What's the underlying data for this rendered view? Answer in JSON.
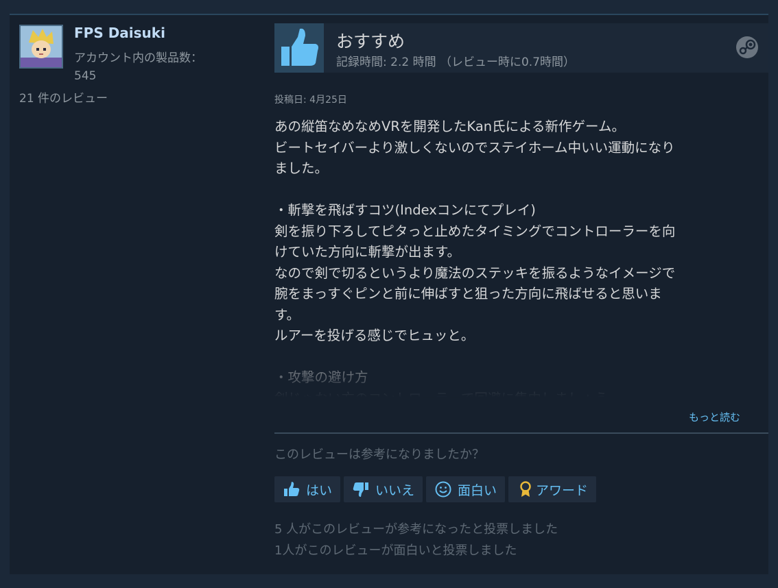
{
  "author": {
    "name": "FPS Daisuki",
    "products_label": "アカウント内の製品数：",
    "products_count": "545",
    "review_count": "21 件のレビュー"
  },
  "header": {
    "recommendation": "おすすめ",
    "hours": "記録時間: 2.2 時間 （レビュー時に0.7時間）"
  },
  "posted": "投稿日: 4月25日",
  "review_lines": [
    "あの縦笛なめなめVRを開発したKan氏による新作ゲーム。",
    "ビートセイバーより激しくないのでステイホーム中いい運動になり",
    "ました。",
    "",
    "・斬撃を飛ばすコツ(Indexコンにてプレイ)",
    "剣を振り下ろしてピタっと止めたタイミングでコントローラーを向",
    "けていた方向に斬撃が出ます。",
    "なので剣で切るというより魔法のステッキを振るようなイメージで",
    "腕をまっすぐピンと前に伸ばすと狙った方向に飛ばせると思いま",
    "す。",
    "ルアーを投げる感じでヒュッと。",
    "",
    "・攻撃の避け方",
    "剣じゃない方のコントローラーで回避に集中しましょう"
  ],
  "read_more": "もっと読む",
  "helpful_question": "このレビューは参考になりましたか？",
  "buttons": {
    "yes": "はい",
    "no": "いいえ",
    "funny": "面白い",
    "award": "アワード"
  },
  "stats": {
    "helpful": "5 人がこのレビューが参考になったと投票しました",
    "funny": "1人がこのレビューが面白いと投票しました"
  },
  "colors": {
    "accent": "#66c0f4",
    "background": "#1b2838",
    "panel": "#16202d"
  }
}
